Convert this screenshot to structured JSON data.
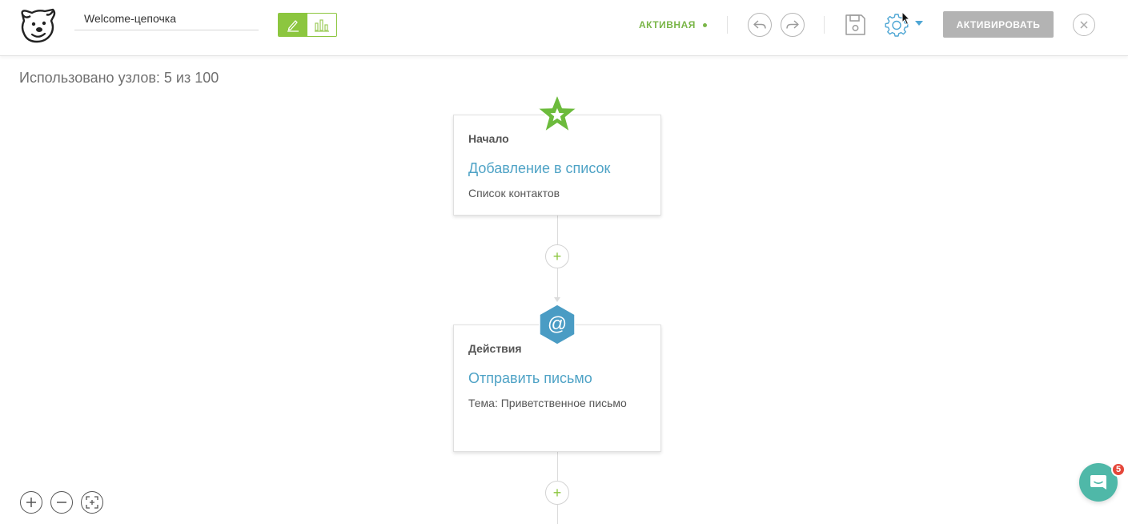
{
  "header": {
    "workflow_name": "Welcome-цепочка",
    "status_label": "АКТИВНАЯ",
    "activate_label": "АКТИВИРОВАТЬ"
  },
  "canvas": {
    "usage_text": "Использовано узлов: 5 из 100",
    "nodes": [
      {
        "label": "Начало",
        "title": "Добавление в список",
        "subtitle": "Список контактов",
        "icon": "star-icon"
      },
      {
        "label": "Действия",
        "title": "Отправить письмо",
        "subtitle": "Тема: Приветственное письмо",
        "icon": "at-sign-icon"
      }
    ],
    "add_node_symbol": "+"
  },
  "chat": {
    "badge_count": "5"
  },
  "colors": {
    "brand_green": "#8cc63f",
    "status_green": "#7ab648",
    "link_blue": "#4fa3c6",
    "gear_blue": "#4ea6d4",
    "hex_blue": "#4a9cc4",
    "chat_teal": "#4fb8a8",
    "badge_red": "#e5473a",
    "disabled_gray": "#b3b3b3"
  }
}
